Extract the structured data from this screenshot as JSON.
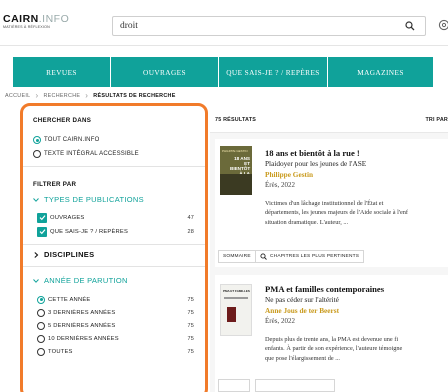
{
  "header": {
    "logo_main": "CAIRN",
    "logo_dot": ".INFO",
    "logo_tagline": "MATIÈRES À RÉFLEXION",
    "search_value": "droit"
  },
  "nav": {
    "tabs": [
      "Revues",
      "Ouvrages",
      "Que sais-je ? / Repères",
      "Magazines"
    ]
  },
  "breadcrumb": {
    "items": [
      "Accueil",
      "Recherche",
      "Résultats de recherche"
    ]
  },
  "filters": {
    "search_in_title": "Chercher dans",
    "search_in_options": [
      {
        "label": "Tout Cairn.info",
        "checked": true
      },
      {
        "label": "Texte intégral accessible",
        "checked": false
      }
    ],
    "filter_by_title": "Filtrer par",
    "types_title": "Types de publications",
    "types": [
      {
        "label": "Ouvrages",
        "count": "47"
      },
      {
        "label": "Que sais-je ? / Repères",
        "count": "28"
      }
    ],
    "disciplines_title": "Disciplines",
    "year_title": "Année de parution",
    "years": [
      {
        "label": "Cette année",
        "count": "75",
        "checked": true
      },
      {
        "label": "3 dernières années",
        "count": "75",
        "checked": false
      },
      {
        "label": "5 dernières années",
        "count": "75",
        "checked": false
      },
      {
        "label": "10 dernières années",
        "count": "75",
        "checked": false
      },
      {
        "label": "Toutes",
        "count": "75",
        "checked": false
      }
    ]
  },
  "results": {
    "count_label": "75 résultats",
    "sort_label": "Tri par",
    "items": [
      {
        "cover_top": "PHILIPPE GESTIN",
        "cover_title": "18 ANS ET BIENTÔT À LA RUE !",
        "title": "18 ans et bientôt à la rue !",
        "subtitle": "Plaidoyer pour les jeunes de l'ASE",
        "author": "Philippe Gestin",
        "publisher": "Érès, 2022",
        "desc_lines": [
          "Victimes d'un lâchage institutionnel de l'État et",
          "départements, les jeunes majeurs de l'Aide sociale à l'enf",
          "situation dramatique. L'auteur, ..."
        ],
        "btn_summary": "Sommaire",
        "btn_chapters": "Chapitres les plus pertinents"
      },
      {
        "cover_top": "PMA ET FAMILLES",
        "title": "PMA et familles contemporaines",
        "subtitle": "Ne pas céder sur l'altérité",
        "author": "Anne Jous de ter Beerst",
        "publisher": "Érès, 2022",
        "desc_lines": [
          "Depuis plus de trente ans, la PMA est devenue une fi",
          "enfants. À partir de son expérience, l'auteure témoigne",
          "que pose l'élargissement de ..."
        ]
      }
    ]
  },
  "colors": {
    "accent": "#10a29a",
    "highlight": "#f17b2a",
    "author": "#c99a1c"
  }
}
